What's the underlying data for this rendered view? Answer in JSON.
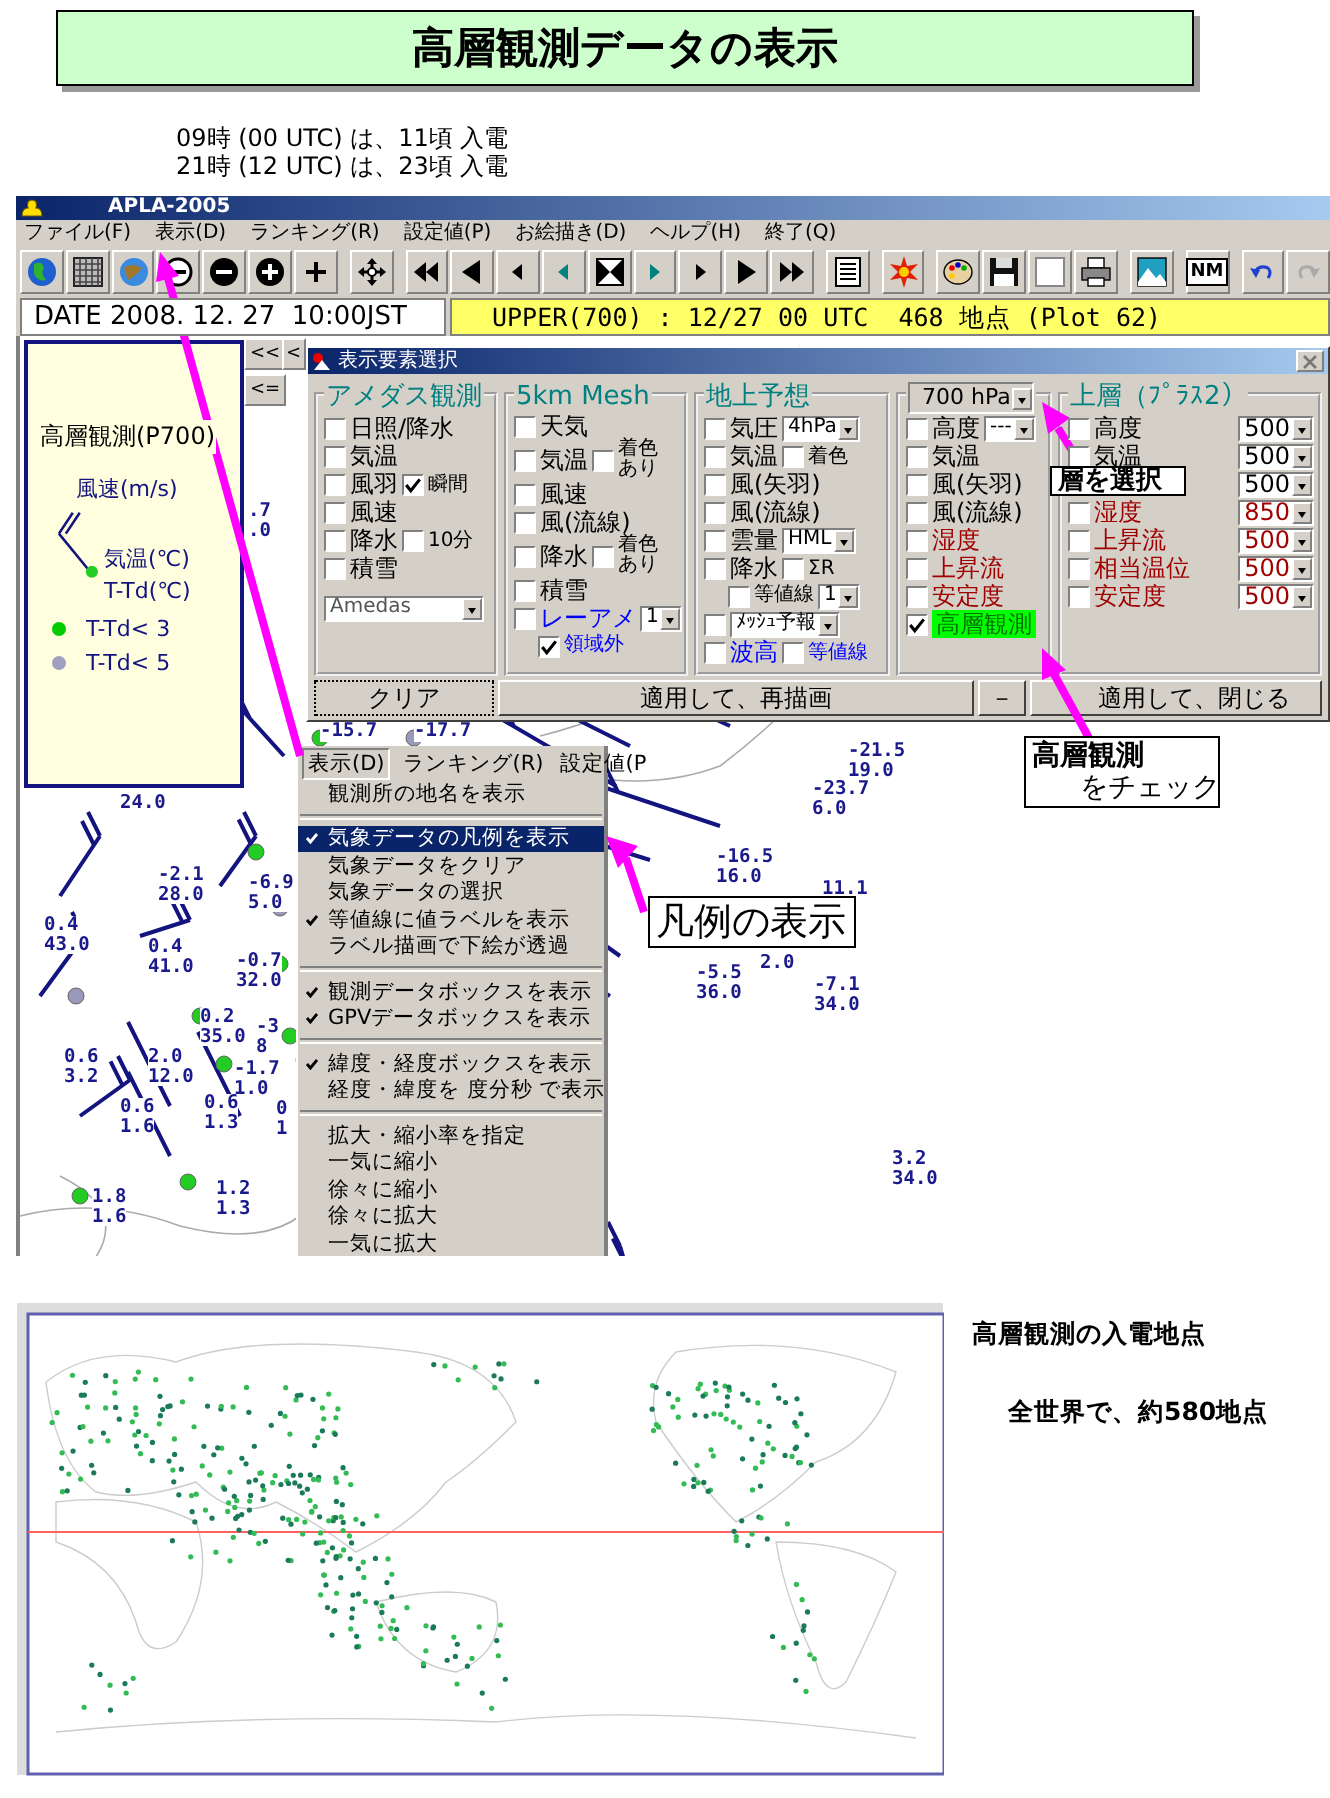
{
  "title": "高層観測データの表示",
  "notes": [
    "09時 (00 UTC) は、11頃 入電",
    "21時 (12 UTC) は、23頃 入電"
  ],
  "app": {
    "title": "APLA-2005",
    "menu": [
      {
        "label": "ファイル(F)"
      },
      {
        "label": "表示(D)"
      },
      {
        "label": "ランキング(R)"
      },
      {
        "label": "設定値(P)"
      },
      {
        "label": "お絵描き(D)"
      },
      {
        "label": "ヘルプ(H)"
      },
      {
        "label": "終了(Q)"
      }
    ],
    "toolbar_label": "NM",
    "date": "DATE 2008. 12. 27  10:00JST",
    "status": "UPPER(700) : 12/27 00 UTC  468 地点 (Plot 62)",
    "nav_buttons": [
      "<<",
      "<",
      "<="
    ],
    "legend": {
      "title": "高層観測(P700)",
      "wind": "風速(m/s)",
      "temp": "気温(℃)",
      "dew": "T-Td(℃)",
      "items": [
        {
          "label": "T-Td< 3",
          "color": "#00cc00"
        },
        {
          "label": "T-Td< 5",
          "color": "#a0a0c0"
        }
      ]
    },
    "dialog": {
      "title": "表示要素選択",
      "groups": [
        {
          "title": "アメダス観測",
          "rows": [
            {
              "label": "日照/降水",
              "checked": false
            },
            {
              "label": "気温",
              "checked": false
            },
            {
              "label": "風羽",
              "checked": false,
              "extra": {
                "kind": "check",
                "label": "瞬間",
                "checked": true
              }
            },
            {
              "label": "風速",
              "checked": false
            },
            {
              "label": "降水",
              "checked": false,
              "extra": {
                "kind": "check",
                "label": "10分",
                "checked": false
              }
            },
            {
              "label": "積雪",
              "checked": false
            }
          ],
          "select": "Amedas"
        },
        {
          "title": "5km Mesh",
          "rows": [
            {
              "label": "天気",
              "checked": false
            },
            {
              "label": "気温",
              "checked": false,
              "extra": {
                "kind": "stack",
                "label": "着色あり",
                "checked": false
              }
            },
            {
              "label": "風速",
              "checked": false
            },
            {
              "label": "風(流線)",
              "checked": false
            },
            {
              "label": "降水",
              "checked": false,
              "extra": {
                "kind": "stack",
                "label": "着色あり",
                "checked": false
              }
            },
            {
              "label": "積雪",
              "checked": false
            },
            {
              "label": "レーアメ",
              "checked": false,
              "color": "#0000ff",
              "extra": {
                "kind": "select",
                "value": "1"
              },
              "children": [
                {
                  "label": "領域外",
                  "checked": true,
                  "color": "#0000ff"
                }
              ]
            }
          ]
        },
        {
          "title": "地上予想",
          "rows": [
            {
              "label": "気圧",
              "checked": false,
              "extra": {
                "kind": "select",
                "value": "4hPa"
              }
            },
            {
              "label": "気温",
              "checked": false,
              "extra": {
                "kind": "check",
                "label": "着色",
                "checked": false
              }
            },
            {
              "label": "風(矢羽)",
              "checked": false
            },
            {
              "label": "風(流線)",
              "checked": false
            },
            {
              "label": "雲量",
              "checked": false,
              "extra": {
                "kind": "select",
                "value": "HML"
              }
            },
            {
              "label": "降水",
              "checked": false,
              "extra": {
                "kind": "check",
                "label": "ΣR",
                "checked": false
              },
              "children": [
                {
                  "label": "等値線",
                  "checked": false,
                  "extra": {
                    "kind": "select",
                    "value": "1"
                  }
                }
              ]
            },
            {
              "checked": false,
              "extra": {
                "kind": "select",
                "value": "ﾒｯｼｭ予報"
              }
            },
            {
              "label": "波高",
              "checked": false,
              "color": "#0000ff",
              "extra": {
                "kind": "check",
                "label": "等値線",
                "checked": false,
                "color": "#0000ff"
              }
            }
          ]
        },
        {
          "header_select": "700 hPa",
          "rows": [
            {
              "label": "高度",
              "checked": false,
              "highlighted": false,
              "extra": {
                "kind": "select",
                "value": "---"
              }
            },
            {
              "label": "気温",
              "checked": false,
              "highlighted": false
            },
            {
              "label": "風(矢羽)",
              "checked": false,
              "highlighted": false
            },
            {
              "label": "風(流線)",
              "checked": false,
              "highlighted": false
            },
            {
              "label": "湿度",
              "checked": false,
              "highlighted": false,
              "color": "#a00000"
            },
            {
              "label": "上昇流",
              "checked": false,
              "highlighted": false,
              "color": "#a00000"
            },
            {
              "label": "安定度",
              "checked": false,
              "highlighted": false,
              "color": "#a00000"
            },
            {
              "label": "高層観測",
              "checked": true,
              "highlighted": true
            }
          ]
        },
        {
          "title": "上層（ﾌﾟﾗｽ2）",
          "rows": [
            {
              "label": "高度",
              "checked": false,
              "extra": {
                "kind": "select",
                "value": "500"
              }
            },
            {
              "label": "気温",
              "checked": false,
              "extra": {
                "kind": "select",
                "value": "500"
              }
            },
            {
              "extra": {
                "kind": "select",
                "value": "500"
              }
            },
            {
              "label": "湿度",
              "checked": false,
              "color": "#a00000",
              "extra": {
                "kind": "select",
                "value": "850",
                "color": "#a00000"
              }
            },
            {
              "label": "上昇流",
              "checked": false,
              "color": "#a00000",
              "extra": {
                "kind": "select",
                "value": "500",
                "color": "#a00000"
              }
            },
            {
              "label": "相当温位",
              "checked": false,
              "color": "#a00000",
              "extra": {
                "kind": "select",
                "value": "500",
                "color": "#a00000"
              }
            },
            {
              "label": "安定度",
              "checked": false,
              "color": "#a00000",
              "extra": {
                "kind": "select",
                "value": "500",
                "color": "#a00000"
              }
            }
          ]
        }
      ],
      "buttons": [
        {
          "label": "クリア"
        },
        {
          "label": "適用して、再描画"
        },
        {
          "label": "－"
        },
        {
          "label": "適用して、閉じる"
        }
      ]
    },
    "popup_menu": {
      "bar": [
        {
          "label": "表示(D)",
          "selected": true
        },
        {
          "label": "ランキング(R)",
          "selected": false
        },
        {
          "label": "設定値(P",
          "selected": false
        }
      ],
      "groups": [
        {
          "items": [
            {
              "label": "観測所の地名を表示",
              "checked": false,
              "selected": false
            }
          ]
        },
        {
          "items": [
            {
              "label": "気象データの凡例を表示",
              "checked": true,
              "selected": true
            },
            {
              "label": "気象データをクリア",
              "checked": false,
              "selected": false
            },
            {
              "label": "気象データの選択",
              "checked": false,
              "selected": false
            },
            {
              "label": "等値線に値ラベルを表示",
              "checked": true,
              "selected": false
            },
            {
              "label": "ラベル描画で下絵が透過",
              "checked": false,
              "selected": false
            }
          ]
        },
        {
          "items": [
            {
              "label": "観測データボックスを表示",
              "checked": true,
              "selected": false
            },
            {
              "label": "GPVデータボックスを表示",
              "checked": true,
              "selected": false
            }
          ]
        },
        {
          "items": [
            {
              "label": "緯度・経度ボックスを表示",
              "checked": true,
              "selected": false
            },
            {
              "label": "経度・緯度を 度分秒 で表示",
              "checked": false,
              "selected": false
            }
          ]
        },
        {
          "items": [
            {
              "label": "拡大・縮小率を指定",
              "checked": false,
              "selected": false
            },
            {
              "label": "一気に縮小",
              "checked": false,
              "selected": false
            },
            {
              "label": "徐々に縮小",
              "checked": false,
              "selected": false
            },
            {
              "label": "徐々に拡大",
              "checked": false,
              "selected": false
            },
            {
              "label": "一気に拡大",
              "checked": false,
              "selected": false
            }
          ]
        }
      ]
    },
    "map_labels": [
      {
        "lines": [
          ".7",
          ".0"
        ]
      },
      {
        "lines": [
          "-15.7"
        ]
      },
      {
        "lines": [
          "-17.7"
        ]
      },
      {
        "lines": [
          "24.0"
        ]
      },
      {
        "lines": [
          "-2.1",
          "28.0"
        ]
      },
      {
        "lines": [
          "-6.9",
          "5.0"
        ]
      },
      {
        "lines": [
          "0.4",
          "43.0"
        ]
      },
      {
        "lines": [
          "0.4",
          "41.0"
        ]
      },
      {
        "lines": [
          "-0.7",
          "32.0"
        ]
      },
      {
        "lines": [
          "0.2",
          "35.0"
        ]
      },
      {
        "lines": [
          "-3",
          "8"
        ]
      },
      {
        "lines": [
          "0.6",
          "3.2"
        ]
      },
      {
        "lines": [
          "2.0",
          "12.0"
        ]
      },
      {
        "lines": [
          "-1.7",
          "1.0"
        ]
      },
      {
        "lines": [
          "0.6",
          "1.6"
        ]
      },
      {
        "lines": [
          "0.6",
          "1.3"
        ]
      },
      {
        "lines": [
          "0",
          "1"
        ]
      },
      {
        "lines": [
          "1.8",
          "1.6"
        ]
      },
      {
        "lines": [
          "1.2",
          "1.3"
        ]
      },
      {
        "lines": [
          "-21.5",
          "19.0"
        ]
      },
      {
        "lines": [
          "-23.7",
          "6.0"
        ]
      },
      {
        "lines": [
          "-16.5",
          "16.0"
        ]
      },
      {
        "lines": [
          "11.1"
        ]
      },
      {
        "lines": [
          "2.0"
        ]
      },
      {
        "lines": [
          "-5.5",
          "36.0"
        ]
      },
      {
        "lines": [
          "-7.1",
          "34.0"
        ]
      },
      {
        "lines": [
          "3.2",
          "34.0"
        ]
      }
    ],
    "callouts": [
      {
        "lines": [
          "凡例の表示"
        ]
      },
      {
        "lines": [
          "層を選択"
        ]
      },
      {
        "lines": [
          "高層観測",
          "をチェック"
        ]
      }
    ]
  },
  "world_map": {
    "caption": "高層観測の入電地点",
    "count": "全世界で、約580地点"
  }
}
